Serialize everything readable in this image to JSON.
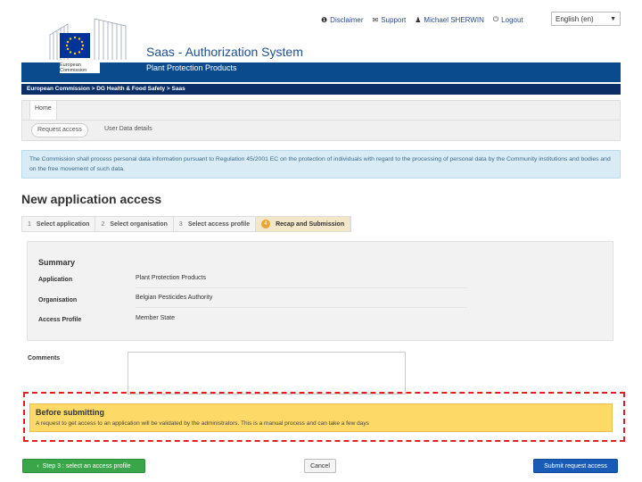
{
  "topbar": {
    "disclaimer": "Disclaimer",
    "support": "Support",
    "user": "Michael SHERWIN",
    "logout": "Logout",
    "language": "English (en)"
  },
  "header": {
    "logo_text": "European Commission",
    "app_title": "Saas - Authorization System",
    "app_subtitle": "Plant Protection Products",
    "breadcrumb": "European Commission > DG Health & Food Safety > Saas"
  },
  "nav": {
    "home": "Home",
    "request_access": "Request access",
    "user_data": "User Data details"
  },
  "info_text": "The Commission shall process personal data information pursuant to Regulation 45/2001 EC on the protection of individuals with regard to the processing of personal data by the Community institutions and bodies and on the free movement of such data.",
  "page_title": "New application access",
  "steps": [
    {
      "num": "1",
      "label": "Select application"
    },
    {
      "num": "2",
      "label": "Select organisation"
    },
    {
      "num": "3",
      "label": "Select access profile"
    },
    {
      "num": "4",
      "label": "Recap and Submission"
    }
  ],
  "summary": {
    "title": "Summary",
    "rows": [
      {
        "label": "Application",
        "value": "Plant Protection Products"
      },
      {
        "label": "Organisation",
        "value": "Belgian Pesticides Authority"
      },
      {
        "label": "Access Profile",
        "value": "Member State"
      }
    ]
  },
  "comments": {
    "label": "Comments",
    "value": ""
  },
  "warning": {
    "title": "Before submitting",
    "text": "A request to get access to an application will be validated by the administrators. This is a manual process and can take a few days"
  },
  "buttons": {
    "back": "Step 3 : select an access profile",
    "cancel": "Cancel",
    "submit": "Submit request access"
  }
}
